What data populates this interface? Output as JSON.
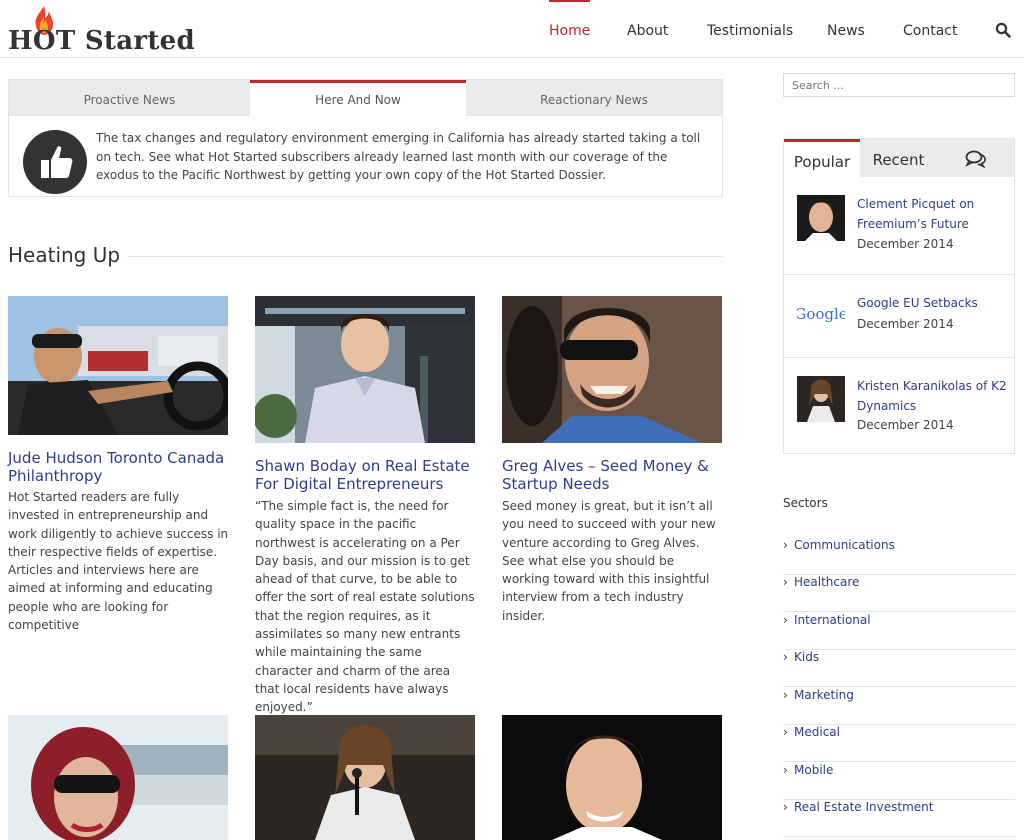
{
  "brand": {
    "logo_text_hot": "HOT",
    "logo_text_rest": " Started"
  },
  "nav": {
    "items": [
      "Home",
      "About",
      "Testimonials",
      "News",
      "Contact"
    ]
  },
  "tabs": {
    "labels": [
      "Proactive News",
      "Here And Now",
      "Reactionary News"
    ],
    "active": "Here And Now",
    "content": "The tax changes and regulatory environment emerging in California has already started taking a toll on tech. See what Hot Started subscribers already learned last month with our coverage of the exodus to the Pacific Northwest by getting your own copy of the Hot Started Dossier."
  },
  "section": {
    "title": "Heating Up"
  },
  "posts": [
    {
      "title": "Jude Hudson Toronto Canada Philanthropy",
      "excerpt": "Hot Started readers are fully invested in entrepreneurship and work diligently to achieve success in their respective fields of expertise. Articles and interviews here are aimed at informing and educating people who are looking for competitive"
    },
    {
      "title": "Shawn Boday on Real Estate For Digital Entrepreneurs",
      "excerpt": "“The simple fact is, the need for quality space in the pacific northwest is accelerating on a Per Day basis, and our mission is to get ahead of that curve, to be able to offer the sort of real estate solutions that the region requires, as it assimilates so many new entrants while maintaining the same character and charm of the area that local residents have always enjoyed.”"
    },
    {
      "title": "Greg Alves – Seed Money & Startup Needs",
      "excerpt": "Seed money is great, but it isn’t all you need to succeed with your new venture according to Greg Alves. See what else you should be working toward with this insightful interview from a tech industry insider."
    }
  ],
  "sidebar": {
    "search_placeholder": "Search ...",
    "tabs": [
      "Popular",
      "Recent"
    ],
    "items": [
      {
        "title": "Clement Picquet on Freemium’s Future",
        "date": "December 2014"
      },
      {
        "title": "Google EU Setbacks",
        "date": "December 2014",
        "thumb_text": "Google"
      },
      {
        "title": "Kristen Karanikolas of K2 Dynamics",
        "date": "December 2014"
      }
    ],
    "sectors_title": "Sectors",
    "sectors": [
      "Communications",
      "Healthcare",
      "International",
      "Kids",
      "Marketing",
      "Medical",
      "Mobile",
      "Real Estate Investment"
    ]
  }
}
